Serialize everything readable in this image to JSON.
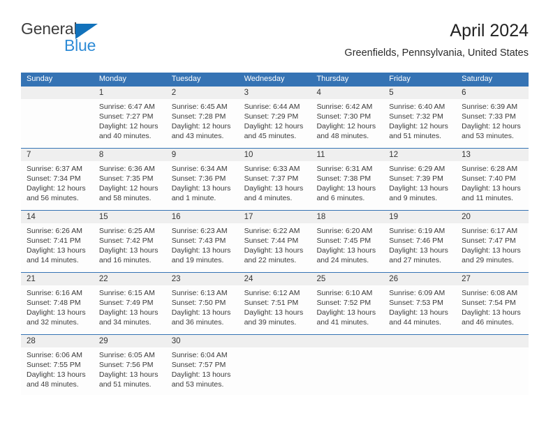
{
  "brand": {
    "name_line1": "General",
    "name_line2": "Blue",
    "flag_icon": "blue-flag-triangle",
    "color_dark": "#3d3d3d",
    "color_blue": "#2e8bd6",
    "color_flag": "#1272bb"
  },
  "header": {
    "title": "April 2024",
    "location": "Greenfields, Pennsylvania, United States"
  },
  "colors": {
    "header_blue": "#3573b4",
    "date_band_gray": "#efefef",
    "cell_white": "#fdfdfd",
    "text_dark": "#333333"
  },
  "weekdays": [
    "Sunday",
    "Monday",
    "Tuesday",
    "Wednesday",
    "Thursday",
    "Friday",
    "Saturday"
  ],
  "weeks": [
    {
      "days": [
        {
          "date": "",
          "sunrise": "",
          "sunset": "",
          "daylight_line1": "",
          "daylight_line2": ""
        },
        {
          "date": "1",
          "sunrise": "Sunrise: 6:47 AM",
          "sunset": "Sunset: 7:27 PM",
          "daylight_line1": "Daylight: 12 hours",
          "daylight_line2": "and 40 minutes."
        },
        {
          "date": "2",
          "sunrise": "Sunrise: 6:45 AM",
          "sunset": "Sunset: 7:28 PM",
          "daylight_line1": "Daylight: 12 hours",
          "daylight_line2": "and 43 minutes."
        },
        {
          "date": "3",
          "sunrise": "Sunrise: 6:44 AM",
          "sunset": "Sunset: 7:29 PM",
          "daylight_line1": "Daylight: 12 hours",
          "daylight_line2": "and 45 minutes."
        },
        {
          "date": "4",
          "sunrise": "Sunrise: 6:42 AM",
          "sunset": "Sunset: 7:30 PM",
          "daylight_line1": "Daylight: 12 hours",
          "daylight_line2": "and 48 minutes."
        },
        {
          "date": "5",
          "sunrise": "Sunrise: 6:40 AM",
          "sunset": "Sunset: 7:32 PM",
          "daylight_line1": "Daylight: 12 hours",
          "daylight_line2": "and 51 minutes."
        },
        {
          "date": "6",
          "sunrise": "Sunrise: 6:39 AM",
          "sunset": "Sunset: 7:33 PM",
          "daylight_line1": "Daylight: 12 hours",
          "daylight_line2": "and 53 minutes."
        }
      ]
    },
    {
      "days": [
        {
          "date": "7",
          "sunrise": "Sunrise: 6:37 AM",
          "sunset": "Sunset: 7:34 PM",
          "daylight_line1": "Daylight: 12 hours",
          "daylight_line2": "and 56 minutes."
        },
        {
          "date": "8",
          "sunrise": "Sunrise: 6:36 AM",
          "sunset": "Sunset: 7:35 PM",
          "daylight_line1": "Daylight: 12 hours",
          "daylight_line2": "and 58 minutes."
        },
        {
          "date": "9",
          "sunrise": "Sunrise: 6:34 AM",
          "sunset": "Sunset: 7:36 PM",
          "daylight_line1": "Daylight: 13 hours",
          "daylight_line2": "and 1 minute."
        },
        {
          "date": "10",
          "sunrise": "Sunrise: 6:33 AM",
          "sunset": "Sunset: 7:37 PM",
          "daylight_line1": "Daylight: 13 hours",
          "daylight_line2": "and 4 minutes."
        },
        {
          "date": "11",
          "sunrise": "Sunrise: 6:31 AM",
          "sunset": "Sunset: 7:38 PM",
          "daylight_line1": "Daylight: 13 hours",
          "daylight_line2": "and 6 minutes."
        },
        {
          "date": "12",
          "sunrise": "Sunrise: 6:29 AM",
          "sunset": "Sunset: 7:39 PM",
          "daylight_line1": "Daylight: 13 hours",
          "daylight_line2": "and 9 minutes."
        },
        {
          "date": "13",
          "sunrise": "Sunrise: 6:28 AM",
          "sunset": "Sunset: 7:40 PM",
          "daylight_line1": "Daylight: 13 hours",
          "daylight_line2": "and 11 minutes."
        }
      ]
    },
    {
      "days": [
        {
          "date": "14",
          "sunrise": "Sunrise: 6:26 AM",
          "sunset": "Sunset: 7:41 PM",
          "daylight_line1": "Daylight: 13 hours",
          "daylight_line2": "and 14 minutes."
        },
        {
          "date": "15",
          "sunrise": "Sunrise: 6:25 AM",
          "sunset": "Sunset: 7:42 PM",
          "daylight_line1": "Daylight: 13 hours",
          "daylight_line2": "and 16 minutes."
        },
        {
          "date": "16",
          "sunrise": "Sunrise: 6:23 AM",
          "sunset": "Sunset: 7:43 PM",
          "daylight_line1": "Daylight: 13 hours",
          "daylight_line2": "and 19 minutes."
        },
        {
          "date": "17",
          "sunrise": "Sunrise: 6:22 AM",
          "sunset": "Sunset: 7:44 PM",
          "daylight_line1": "Daylight: 13 hours",
          "daylight_line2": "and 22 minutes."
        },
        {
          "date": "18",
          "sunrise": "Sunrise: 6:20 AM",
          "sunset": "Sunset: 7:45 PM",
          "daylight_line1": "Daylight: 13 hours",
          "daylight_line2": "and 24 minutes."
        },
        {
          "date": "19",
          "sunrise": "Sunrise: 6:19 AM",
          "sunset": "Sunset: 7:46 PM",
          "daylight_line1": "Daylight: 13 hours",
          "daylight_line2": "and 27 minutes."
        },
        {
          "date": "20",
          "sunrise": "Sunrise: 6:17 AM",
          "sunset": "Sunset: 7:47 PM",
          "daylight_line1": "Daylight: 13 hours",
          "daylight_line2": "and 29 minutes."
        }
      ]
    },
    {
      "days": [
        {
          "date": "21",
          "sunrise": "Sunrise: 6:16 AM",
          "sunset": "Sunset: 7:48 PM",
          "daylight_line1": "Daylight: 13 hours",
          "daylight_line2": "and 32 minutes."
        },
        {
          "date": "22",
          "sunrise": "Sunrise: 6:15 AM",
          "sunset": "Sunset: 7:49 PM",
          "daylight_line1": "Daylight: 13 hours",
          "daylight_line2": "and 34 minutes."
        },
        {
          "date": "23",
          "sunrise": "Sunrise: 6:13 AM",
          "sunset": "Sunset: 7:50 PM",
          "daylight_line1": "Daylight: 13 hours",
          "daylight_line2": "and 36 minutes."
        },
        {
          "date": "24",
          "sunrise": "Sunrise: 6:12 AM",
          "sunset": "Sunset: 7:51 PM",
          "daylight_line1": "Daylight: 13 hours",
          "daylight_line2": "and 39 minutes."
        },
        {
          "date": "25",
          "sunrise": "Sunrise: 6:10 AM",
          "sunset": "Sunset: 7:52 PM",
          "daylight_line1": "Daylight: 13 hours",
          "daylight_line2": "and 41 minutes."
        },
        {
          "date": "26",
          "sunrise": "Sunrise: 6:09 AM",
          "sunset": "Sunset: 7:53 PM",
          "daylight_line1": "Daylight: 13 hours",
          "daylight_line2": "and 44 minutes."
        },
        {
          "date": "27",
          "sunrise": "Sunrise: 6:08 AM",
          "sunset": "Sunset: 7:54 PM",
          "daylight_line1": "Daylight: 13 hours",
          "daylight_line2": "and 46 minutes."
        }
      ]
    },
    {
      "days": [
        {
          "date": "28",
          "sunrise": "Sunrise: 6:06 AM",
          "sunset": "Sunset: 7:55 PM",
          "daylight_line1": "Daylight: 13 hours",
          "daylight_line2": "and 48 minutes."
        },
        {
          "date": "29",
          "sunrise": "Sunrise: 6:05 AM",
          "sunset": "Sunset: 7:56 PM",
          "daylight_line1": "Daylight: 13 hours",
          "daylight_line2": "and 51 minutes."
        },
        {
          "date": "30",
          "sunrise": "Sunrise: 6:04 AM",
          "sunset": "Sunset: 7:57 PM",
          "daylight_line1": "Daylight: 13 hours",
          "daylight_line2": "and 53 minutes."
        },
        {
          "date": "",
          "sunrise": "",
          "sunset": "",
          "daylight_line1": "",
          "daylight_line2": ""
        },
        {
          "date": "",
          "sunrise": "",
          "sunset": "",
          "daylight_line1": "",
          "daylight_line2": ""
        },
        {
          "date": "",
          "sunrise": "",
          "sunset": "",
          "daylight_line1": "",
          "daylight_line2": ""
        },
        {
          "date": "",
          "sunrise": "",
          "sunset": "",
          "daylight_line1": "",
          "daylight_line2": ""
        }
      ]
    }
  ]
}
